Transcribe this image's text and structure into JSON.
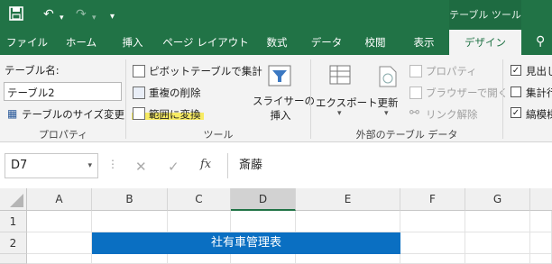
{
  "quick_access": {
    "save_icon": "save-icon",
    "undo_icon": "undo-icon",
    "redo_icon": "redo-icon",
    "customize_icon": "dropdown-icon"
  },
  "context_title": "テーブル ツール",
  "tabs": [
    "ファイル",
    "ホーム",
    "挿入",
    "ページ レイアウト",
    "数式",
    "データ",
    "校閲",
    "表示",
    "デザイン"
  ],
  "help_icon": "lightbulb-icon",
  "ribbon": {
    "properties": {
      "table_name_label": "テーブル名:",
      "table_name_value": "テーブル2",
      "resize_label": "テーブルのサイズ変更",
      "group_label": "プロパティ"
    },
    "tools": {
      "pivot_label": "ピボットテーブルで集計",
      "remove_duplicates_label": "重複の削除",
      "convert_to_range_label": "範囲に変換",
      "slicer_label_1": "スライサーの",
      "slicer_label_2": "挿入",
      "group_label": "ツール"
    },
    "external": {
      "export_label": "エクスポート",
      "refresh_label": "更新",
      "properties_label": "プロパティ",
      "browser_label": "ブラウザーで開く",
      "unlink_label": "リンク解除",
      "group_label": "外部のテーブル データ"
    },
    "style_options": {
      "header_row_label": "見出し",
      "header_row_checked": true,
      "total_row_label": "集計行",
      "total_row_checked": false,
      "banded_rows_label": "縞模様",
      "banded_rows_checked": true
    }
  },
  "formula_bar": {
    "name_box": "D7",
    "cancel_icon": "cancel-icon",
    "enter_icon": "enter-icon",
    "fx_label": "fx",
    "formula_value": "斎藤"
  },
  "sheet": {
    "columns": [
      "A",
      "B",
      "C",
      "D",
      "E",
      "F",
      "G"
    ],
    "rows": [
      "1",
      "2"
    ],
    "selected_column": "D",
    "title_text": "社有車管理表",
    "title_fill": "#0a6fc2"
  },
  "colors": {
    "excel_green": "#217346",
    "highlight_yellow": "#f7e94a"
  }
}
